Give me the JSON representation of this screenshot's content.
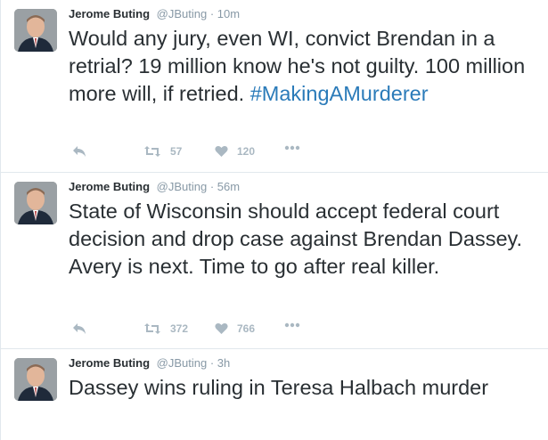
{
  "tweets": [
    {
      "name": "Jerome Buting",
      "handle": "@JButing",
      "dot": "·",
      "time": "10m",
      "text": "Would any jury, even WI, convict Brendan in a retrial? 19 million know he's not guilty. 100 million more will, if retried.",
      "hashtag": "#MakingAMurderer",
      "retweets": "57",
      "likes": "120"
    },
    {
      "name": "Jerome Buting",
      "handle": "@JButing",
      "dot": "·",
      "time": "56m",
      "text": "State of Wisconsin should accept federal court decision and drop case against Brendan Dassey. Avery is next. Time to go after real killer.",
      "retweets": "372",
      "likes": "766"
    },
    {
      "name": "Jerome Buting",
      "handle": "@JButing",
      "dot": "·",
      "time": "3h",
      "text": "Dassey wins ruling in Teresa Halbach murder"
    }
  ],
  "icons": {
    "reply": "reply-icon",
    "retweet": "retweet-icon",
    "like": "heart-icon",
    "more": "more-icon"
  },
  "colors": {
    "text": "#292f33",
    "muted": "#8899a6",
    "action": "#aab8c2",
    "link": "#2b7bb9",
    "divider": "#e1e8ed"
  }
}
